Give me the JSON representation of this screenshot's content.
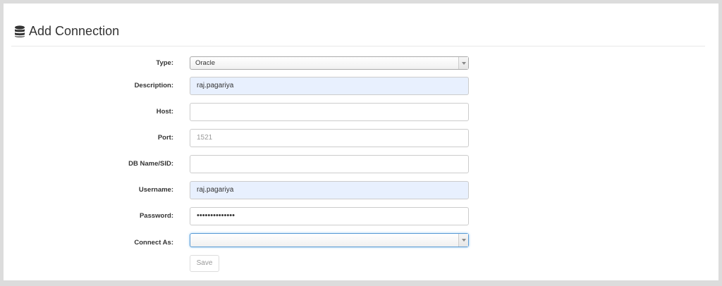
{
  "panel": {
    "title": "Add Connection",
    "icon": "database-icon"
  },
  "form": {
    "type": {
      "label": "Type:",
      "value": "Oracle"
    },
    "description": {
      "label": "Description:",
      "value": "raj.pagariya"
    },
    "host": {
      "label": "Host:",
      "value": ""
    },
    "port": {
      "label": "Port:",
      "placeholder": "1521"
    },
    "dbname": {
      "label": "DB Name/SID:",
      "value": ""
    },
    "username": {
      "label": "Username:",
      "value": "raj.pagariya"
    },
    "password": {
      "label": "Password:",
      "value": "••••••••••••••"
    },
    "connect_as": {
      "label": "Connect As:",
      "value": ""
    },
    "save_label": "Save"
  },
  "colors": {
    "autofill_bg": "#e8f0fe",
    "focus_border": "#5b9bd5"
  }
}
